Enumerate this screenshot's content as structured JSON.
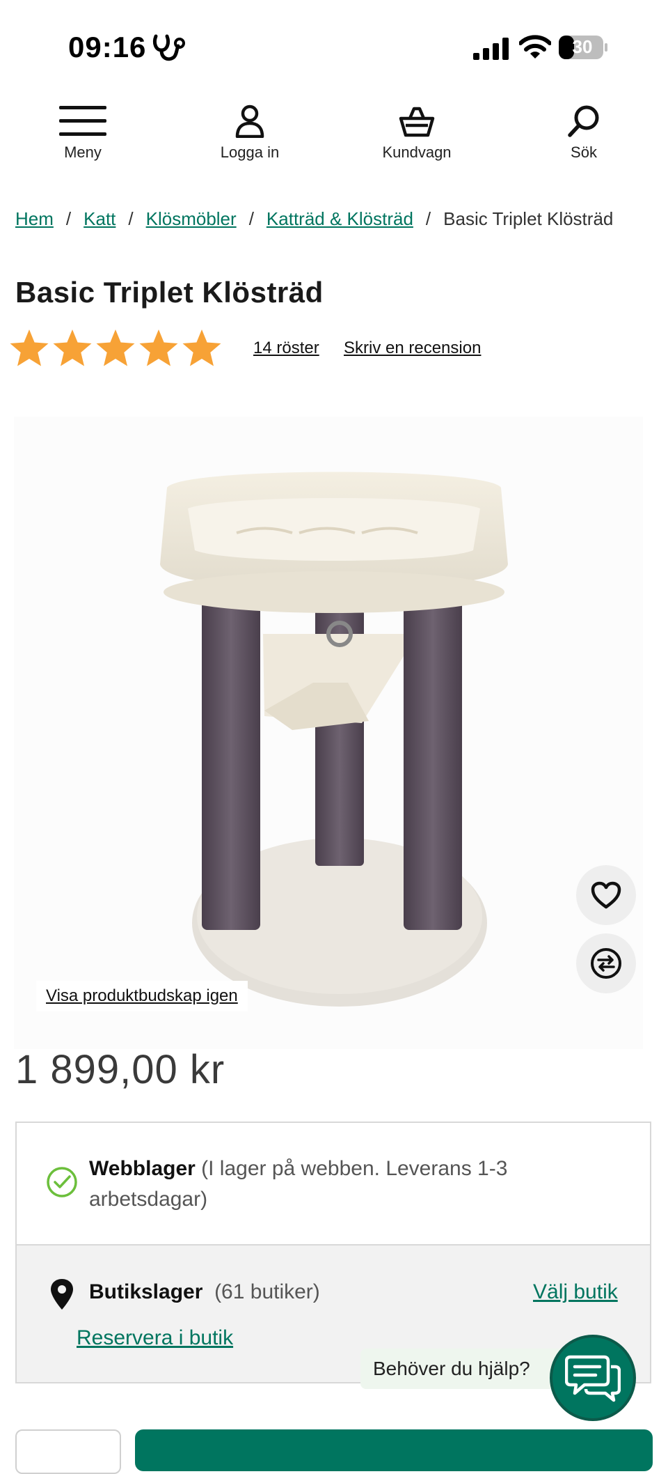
{
  "status_bar": {
    "time": "09:16",
    "battery": "30"
  },
  "nav": {
    "menu": "Meny",
    "login": "Logga in",
    "cart": "Kundvagn",
    "search": "Sök"
  },
  "breadcrumb": {
    "items": [
      "Hem",
      "Katt",
      "Klösmöbler",
      "Katträd & Klösträd"
    ],
    "current": "Basic Triplet Klösträd"
  },
  "product": {
    "title": "Basic Triplet Klösträd",
    "rating": 5,
    "votes": "14 röster",
    "write_review": "Skriv en recension",
    "show_message": "Visa produktbudskap igen",
    "price": "1 899,00 kr"
  },
  "stock": {
    "web_label": "Webblager",
    "web_detail": " (I lager på webben. Leverans 1-3 arbetsdagar)",
    "store_label": "Butikslager",
    "store_detail": "(61 butiker)",
    "choose_store": "Välj butik",
    "reserve": "Reservera i butik"
  },
  "help": {
    "label": "Behöver du hjälp?"
  },
  "colors": {
    "accent": "#00755f",
    "star": "#f7a236"
  }
}
